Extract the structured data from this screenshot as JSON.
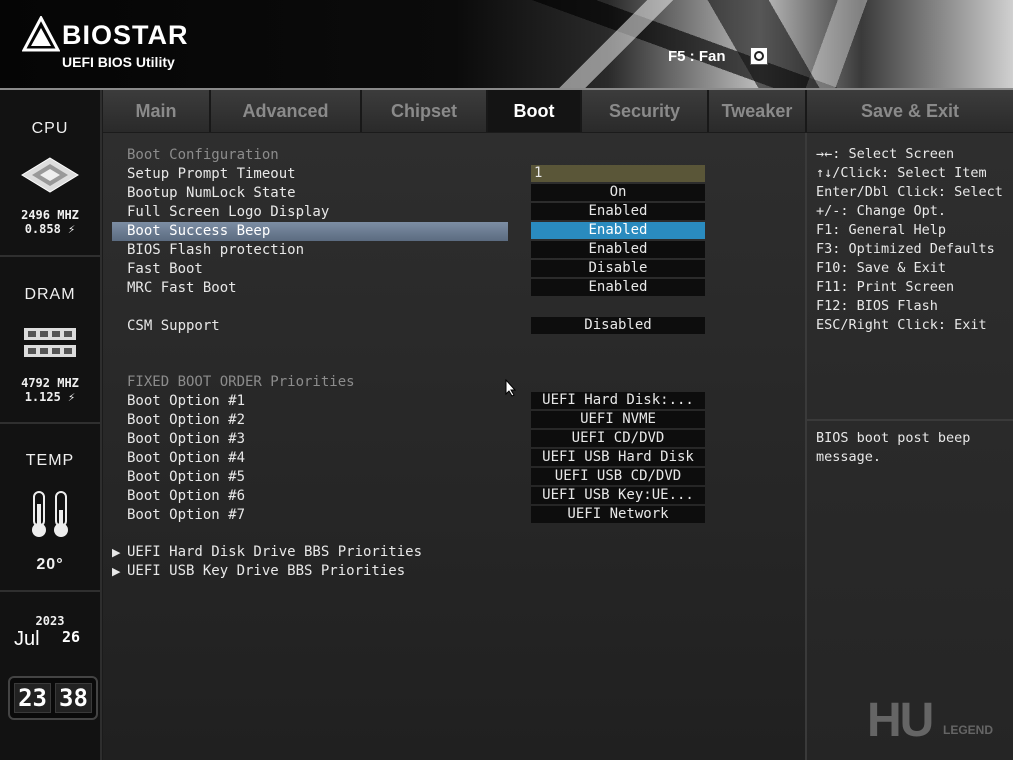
{
  "header": {
    "brand": "BIOSTAR",
    "subtitle": "UEFI BIOS Utility",
    "fan_hint": "F5 : Fan"
  },
  "sidebar": {
    "cpu": {
      "title": "CPU",
      "freq": "2496 MHZ",
      "volt": "0.858 ⚡"
    },
    "dram": {
      "title": "DRAM",
      "freq": "4792 MHZ",
      "volt": "1.125 ⚡"
    },
    "temp": {
      "title": "TEMP",
      "value": "20°"
    },
    "date": {
      "year": "2023",
      "month": "Jul",
      "day": "26"
    },
    "time": {
      "hour": "23",
      "minute": "38"
    }
  },
  "tabs": [
    "Main",
    "Advanced",
    "Chipset",
    "Boot",
    "Security",
    "Tweaker",
    "Save & Exit"
  ],
  "active_tab": "Boot",
  "boot": {
    "section_config": "Boot Configuration",
    "settings": [
      {
        "label": "Setup Prompt Timeout",
        "value": "1"
      },
      {
        "label": "Bootup NumLock State",
        "value": "On"
      },
      {
        "label": "Full Screen Logo Display",
        "value": "Enabled"
      },
      {
        "label": "Boot Success Beep",
        "value": "Enabled"
      },
      {
        "label": "BIOS Flash protection",
        "value": "Enabled"
      },
      {
        "label": "Fast Boot",
        "value": "Disable"
      },
      {
        "label": "MRC Fast Boot",
        "value": "Enabled"
      }
    ],
    "csm": {
      "label": "CSM Support",
      "value": "Disabled"
    },
    "section_order": "FIXED BOOT ORDER Priorities",
    "options": [
      {
        "label": "Boot Option #1",
        "value": "UEFI Hard Disk:..."
      },
      {
        "label": "Boot Option #2",
        "value": "UEFI NVME"
      },
      {
        "label": "Boot Option #3",
        "value": "UEFI CD/DVD"
      },
      {
        "label": "Boot Option #4",
        "value": "UEFI USB Hard Disk"
      },
      {
        "label": "Boot Option #5",
        "value": "UEFI USB CD/DVD"
      },
      {
        "label": "Boot Option #6",
        "value": "UEFI USB Key:UE..."
      },
      {
        "label": "Boot Option #7",
        "value": "UEFI Network"
      }
    ],
    "submenus": [
      "UEFI Hard Disk Drive BBS Priorities",
      "UEFI USB Key Drive BBS Priorities"
    ]
  },
  "help": {
    "keys": [
      "→←: Select Screen",
      "↑↓/Click: Select Item",
      "Enter/Dbl Click: Select",
      "+/-: Change Opt.",
      "F1: General Help",
      "F3: Optimized Defaults",
      "F10: Save & Exit",
      "F11: Print Screen",
      "F12: BIOS Flash",
      "ESC/Right Click: Exit"
    ],
    "description": "BIOS boot post beep message."
  },
  "watermark": {
    "big": "HU",
    "small": "LEGEND"
  },
  "colors": {
    "selected": "#2a8bbf",
    "highlight": "#6d7e94",
    "input": "#5a5638"
  }
}
